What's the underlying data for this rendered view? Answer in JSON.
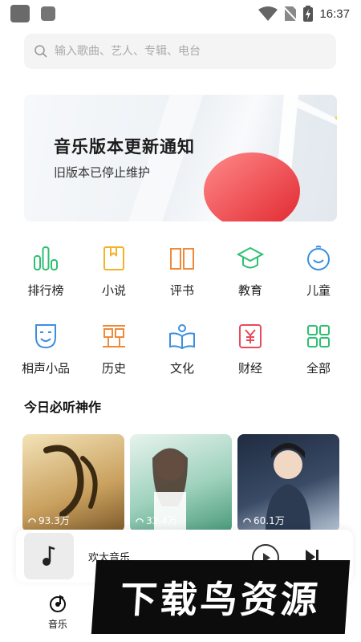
{
  "status_bar": {
    "time": "16:37"
  },
  "search": {
    "placeholder": "输入歌曲、艺人、专辑、电台"
  },
  "banner": {
    "title": "音乐版本更新通知",
    "subtitle": "旧版本已停止维护"
  },
  "categories": [
    {
      "label": "排行榜",
      "icon": "ranking-icon",
      "color": "#2fbf71"
    },
    {
      "label": "小说",
      "icon": "novel-icon",
      "color": "#f2b32a"
    },
    {
      "label": "评书",
      "icon": "storytelling-book-icon",
      "color": "#f08a3b"
    },
    {
      "label": "教育",
      "icon": "graduation-cap-icon",
      "color": "#2fbf71"
    },
    {
      "label": "儿童",
      "icon": "children-face-icon",
      "color": "#3b8fe0"
    },
    {
      "label": "相声小品",
      "icon": "comedy-mask-icon",
      "color": "#3b8fe0"
    },
    {
      "label": "历史",
      "icon": "history-icon",
      "color": "#f08a3b"
    },
    {
      "label": "文化",
      "icon": "culture-reading-icon",
      "color": "#3b8fe0"
    },
    {
      "label": "财经",
      "icon": "finance-yen-icon",
      "color": "#e84a5a"
    },
    {
      "label": "全部",
      "icon": "grid-all-icon",
      "color": "#2fbf71"
    }
  ],
  "section": {
    "title": "今日必听神作"
  },
  "cards": [
    {
      "plays": "93.3万",
      "bg": "#c8a46a"
    },
    {
      "plays": "33.4万",
      "bg": "#6fb89a"
    },
    {
      "plays": "60.1万",
      "bg": "#3a4b66"
    }
  ],
  "player": {
    "song": "欢太音乐"
  },
  "nav": {
    "music_label": "音乐"
  },
  "watermark": {
    "text": "下载鸟资源"
  }
}
